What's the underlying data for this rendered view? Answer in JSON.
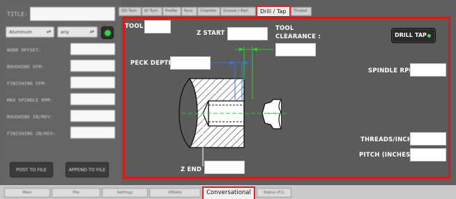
{
  "left_panel": {
    "title_label": "TITLE:",
    "material_select": "Aluminum",
    "unit_select": "any",
    "fields": [
      {
        "label": "WORK OFFSET:"
      },
      {
        "label": "ROUGHING SFM:"
      },
      {
        "label": "FINISHING SFM:"
      },
      {
        "label": "MAX SPINDLE RPM:"
      },
      {
        "label": "ROUGHING IN/REV:"
      },
      {
        "label": "FINISHING IN/REV:"
      }
    ],
    "post_button": "POST TO FILE",
    "append_button": "APPEND TO FILE"
  },
  "top_tabs": [
    "OD Turn",
    "ID Turn",
    "Profile",
    "Face",
    "Chamfer",
    "Groove / Part",
    "Drill / Tap",
    "Thread"
  ],
  "active_top_tab": "Drill / Tap",
  "bottom_tabs": [
    "Main",
    "File",
    "Settings",
    "Offsets",
    "Conversational",
    "Status (F1)"
  ],
  "active_bottom_tab": "Conversational",
  "drill_tap": {
    "tool_label": "TOOL :",
    "z_start_label": "Z START :",
    "tool_clearance_label_1": "TOOL",
    "tool_clearance_label_2": "CLEARANCE :",
    "peck_depth_label": "PECK DEPTH :",
    "spindle_rpm_label": "SPINDLE RPM :",
    "z_end_label": "Z END :",
    "threads_inch_label": "THREADS/INCH :",
    "pitch_label": "PITCH (INCHES) :",
    "toggle_left": "DRILL",
    "toggle_right": "TAP",
    "toggle_state": "TAP",
    "indicator_color": "#3fe04f",
    "accent_color": "#e01515"
  }
}
